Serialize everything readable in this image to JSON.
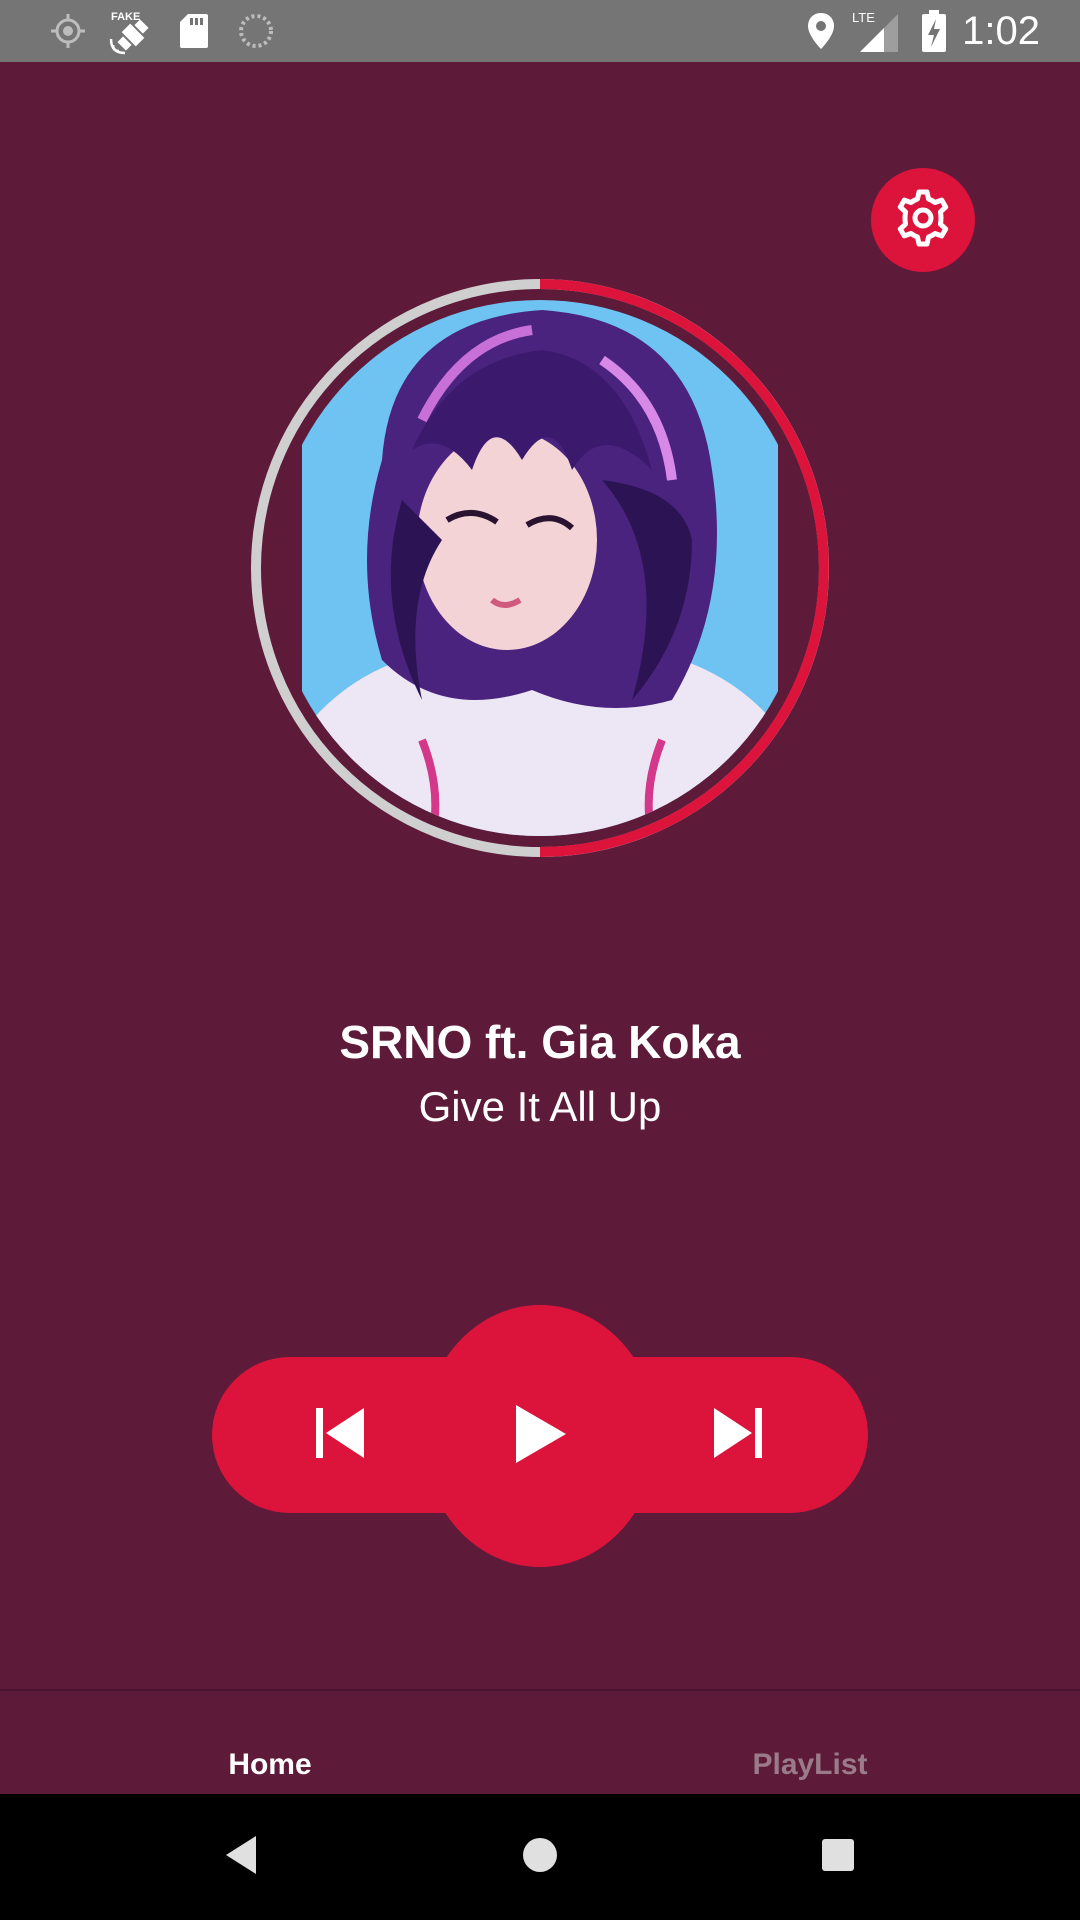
{
  "status_bar": {
    "time": "1:02",
    "icons": [
      "gps-icon",
      "fake-gps-icon",
      "sd-card-icon",
      "sync-icon",
      "location-icon",
      "lte-signal-icon",
      "battery-charging-icon"
    ],
    "network_label": "LTE",
    "fake_label": "FAKE"
  },
  "player": {
    "artist": "SRNO ft. Gia Koka",
    "title": "Give It All Up",
    "progress": 0.5,
    "accent_color": "#dc143c",
    "background_color": "#5e1a39"
  },
  "controls": {
    "previous_icon": "skip-previous-icon",
    "play_icon": "play-icon",
    "next_icon": "skip-next-icon",
    "settings_icon": "gear-icon"
  },
  "bottom_nav": {
    "items": [
      {
        "label": "Home",
        "active": true
      },
      {
        "label": "PlayList",
        "active": false
      }
    ]
  },
  "system_nav": {
    "icons": [
      "back-icon",
      "home-icon",
      "recents-icon"
    ]
  }
}
